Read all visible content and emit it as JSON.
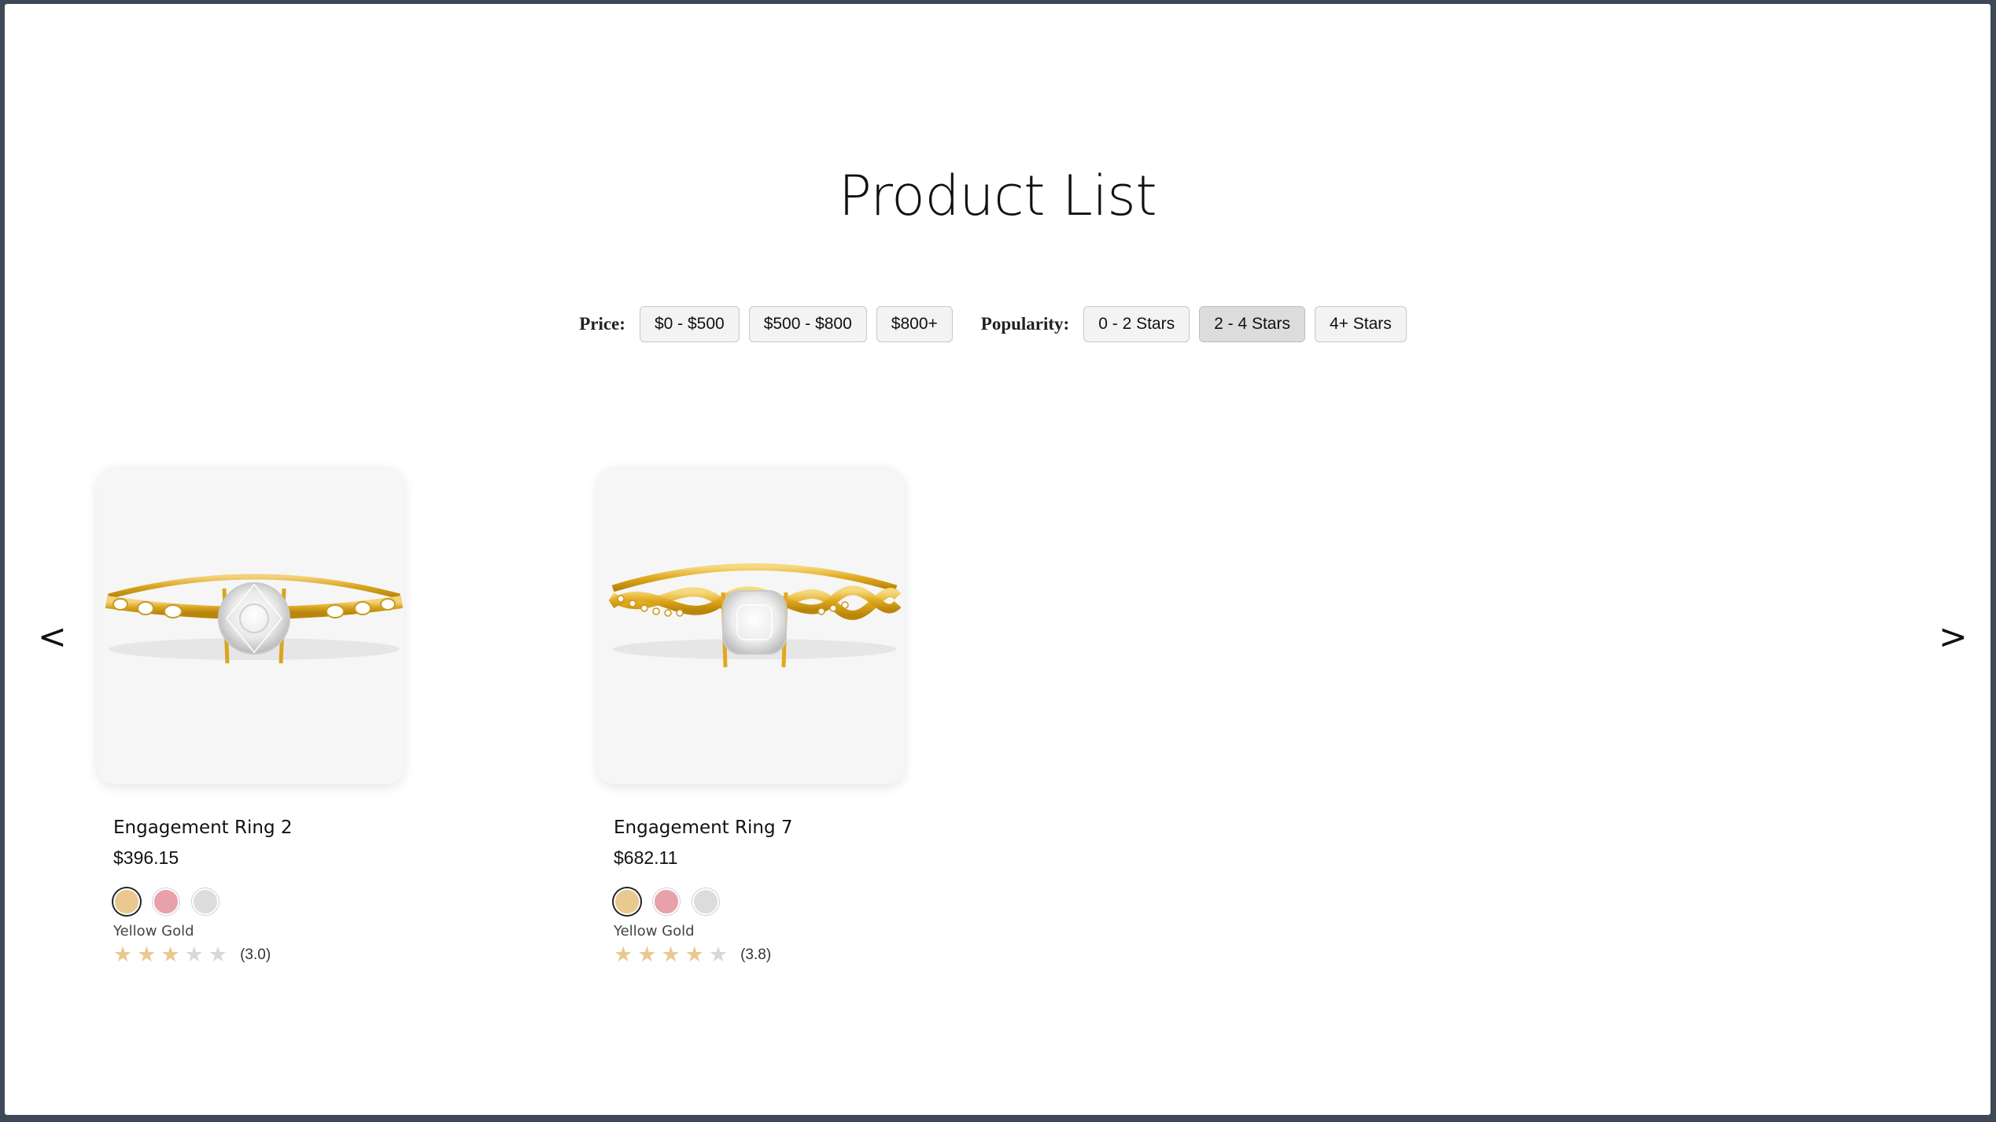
{
  "page": {
    "title": "Product List"
  },
  "filters": {
    "price_label": "Price:",
    "price_options": [
      "$0 - $500",
      "$500 - $800",
      "$800+"
    ],
    "popularity_label": "Popularity:",
    "popularity_options": [
      "0 - 2 Stars",
      "2 - 4 Stars",
      "4+ Stars"
    ],
    "active_popularity": "2 - 4 Stars"
  },
  "carousel": {
    "prev_label": "<",
    "next_label": ">"
  },
  "products": [
    {
      "name": "Engagement Ring 2",
      "price": "$396.15",
      "metal": "Yellow Gold",
      "rating": 3.0,
      "rating_text": "(3.0)",
      "stars_filled": 3,
      "image_icon": "ring-image"
    },
    {
      "name": "Engagement Ring 7",
      "price": "$682.11",
      "metal": "Yellow Gold",
      "rating": 3.8,
      "rating_text": "(3.8)",
      "stars_filled": 4,
      "image_icon": "ring-image"
    }
  ],
  "swatch_colors": {
    "yellow_gold": "#e9c98f",
    "rose_gold": "#e8a1a8",
    "white_gold": "#dcdcdc"
  },
  "colors": {
    "star_on": "#e9c98f",
    "star_off": "#d8d8d8",
    "gold": "#d9a520"
  },
  "stars_total": 5
}
